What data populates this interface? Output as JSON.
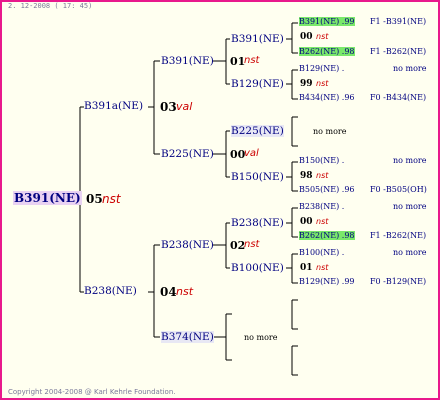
{
  "header": {
    "date": "2. 12-2008 ( 17: 45)"
  },
  "footer": {
    "copyright": "Copyright 2004-2008 @ Karl Kehrle Foundation."
  },
  "colors": {
    "border": "#e8198c",
    "node_text": "#000080",
    "tag_text": "#cc0000",
    "highlight": "#7ae86a",
    "root_bg": "#e9d2f2"
  },
  "root": {
    "name": "B391(NE)",
    "num": "05",
    "tag": "nst"
  },
  "gen1": [
    {
      "name": "B391a(NE)",
      "num": "03",
      "tag": "val"
    },
    {
      "name": "B238(NE)",
      "num": "04",
      "tag": "nst"
    }
  ],
  "gen2": [
    {
      "name": "B391(NE)",
      "num": "01",
      "tag": "nst"
    },
    {
      "name": "B225(NE)",
      "num": "00",
      "tag": "val"
    },
    {
      "name": "B238(NE)",
      "num": "02",
      "tag": "nst"
    },
    {
      "name": "B374(NE)",
      "no_more": "no more"
    }
  ],
  "gen3": [
    {
      "name": "B391(NE)"
    },
    {
      "name": "B129(NE)"
    },
    {
      "name": "B225(NE)",
      "no_more": "no more"
    },
    {
      "name": "B150(NE)"
    },
    {
      "name": "B238(NE)"
    },
    {
      "name": "B100(NE)"
    }
  ],
  "gen4": [
    {
      "line1": "B391(NE) .99",
      "num": "00",
      "tag": "nst",
      "line3": "B262(NE) .98",
      "ref1": "F1 -B391(NE)",
      "ref3": "F1 -B262(NE)"
    },
    {
      "line1": "B129(NE) .",
      "num": "99",
      "tag": "nst",
      "line3": "B434(NE) .96",
      "ref1": "no more",
      "ref3": "F0 -B434(NE)"
    },
    {
      "line1": "B150(NE) .",
      "num": "98",
      "tag": "nst",
      "line3": "B505(NE) .96",
      "ref1": "no more",
      "ref3": "F0 -B505(OH)"
    },
    {
      "line1": "B238(NE) .",
      "num": "00",
      "tag": "nst",
      "line3": "B262(NE) .98",
      "ref1": "no more",
      "ref3": "F1 -B262(NE)"
    },
    {
      "line1": "B100(NE) .",
      "num": "01",
      "tag": "nst",
      "line3": "B129(NE) .99",
      "ref1": "no more",
      "ref3": "F0 -B129(NE)"
    }
  ]
}
